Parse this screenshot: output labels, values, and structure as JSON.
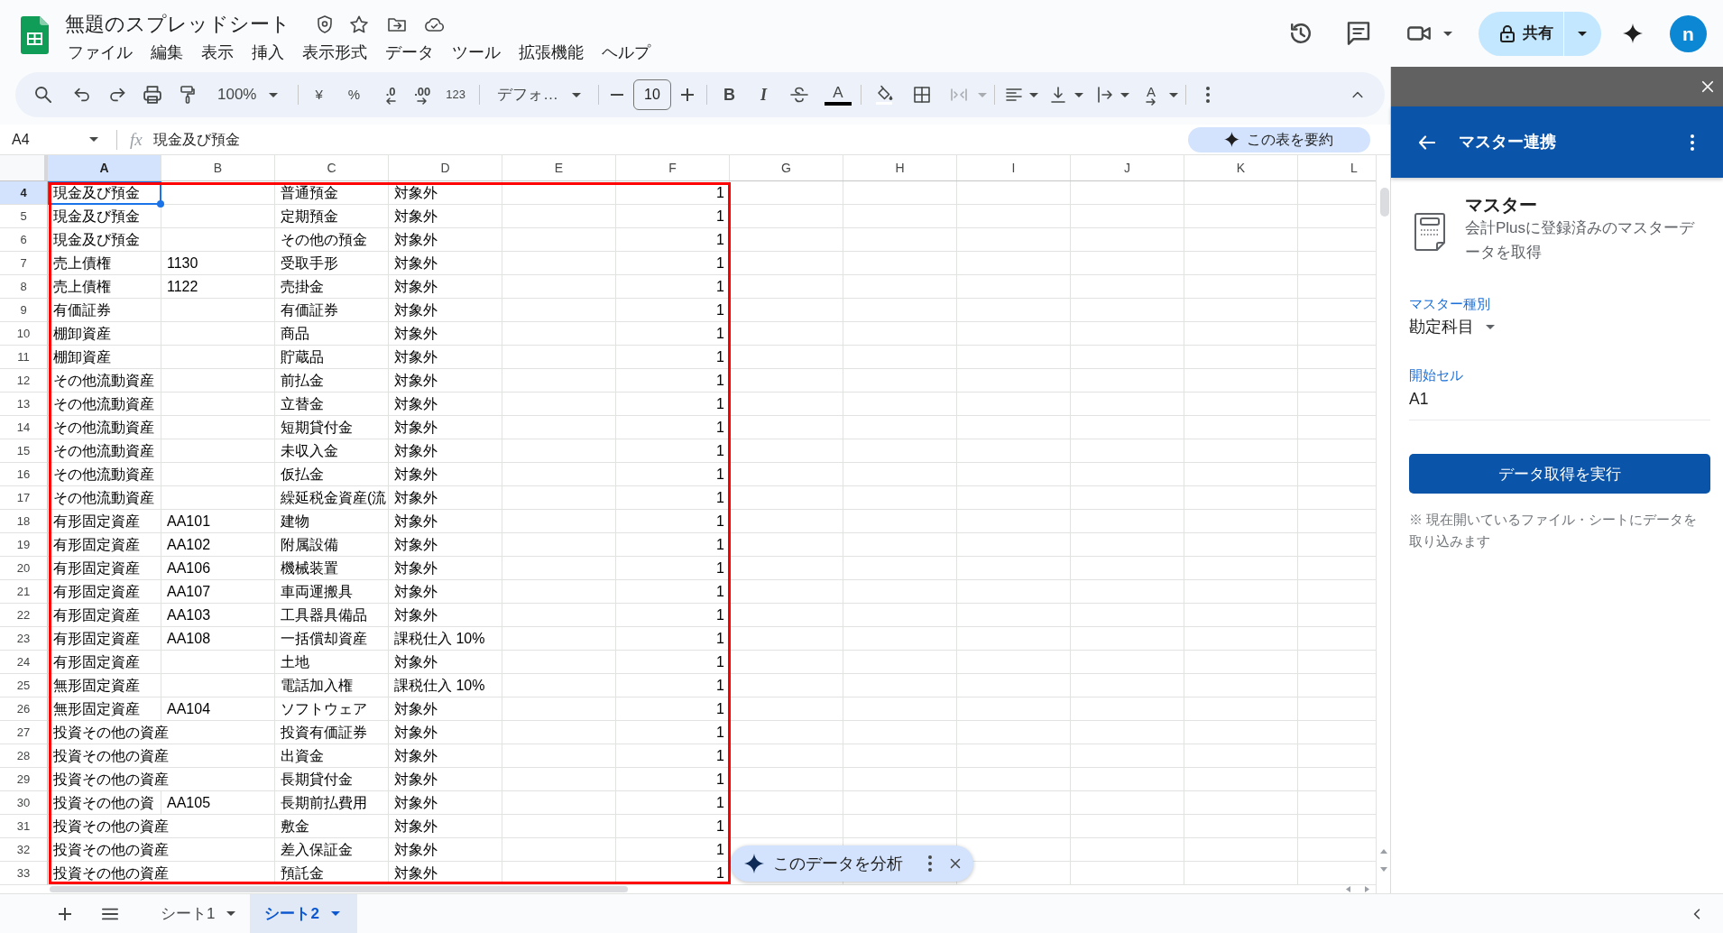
{
  "document": {
    "title": "無題のスプレッドシート"
  },
  "menu": [
    "ファイル",
    "編集",
    "表示",
    "挿入",
    "表示形式",
    "データ",
    "ツール",
    "拡張機能",
    "ヘルプ"
  ],
  "share": {
    "label": "共有"
  },
  "account": {
    "initial": "n"
  },
  "toolbar": {
    "zoom": "100%",
    "currency": "¥",
    "percent": "%",
    "decrease_decimal": ".0",
    "increase_decimal": ".00",
    "number_format": "123",
    "font": "デフォ…",
    "font_size": "10",
    "bold": "B",
    "italic": "I",
    "text_color": "A",
    "text_rotation": "A"
  },
  "formula_bar": {
    "cell_reference": "A4",
    "function_label": "fx",
    "content": "現金及び預金",
    "summarize_button": "この表を要約"
  },
  "grid": {
    "annotation_frame": true,
    "columns": [
      {
        "label": "A",
        "kind": "text",
        "selected": true
      },
      {
        "label": "B",
        "kind": "text",
        "selected": false
      },
      {
        "label": "C",
        "kind": "text",
        "selected": false
      },
      {
        "label": "D",
        "kind": "text",
        "selected": false
      },
      {
        "label": "E",
        "kind": "text",
        "selected": false
      },
      {
        "label": "F",
        "kind": "number",
        "selected": false
      },
      {
        "label": "G",
        "kind": "text",
        "selected": false
      },
      {
        "label": "H",
        "kind": "text",
        "selected": false
      },
      {
        "label": "I",
        "kind": "text",
        "selected": false
      },
      {
        "label": "J",
        "kind": "text",
        "selected": false
      },
      {
        "label": "K",
        "kind": "text",
        "selected": false
      },
      {
        "label": "L",
        "kind": "text",
        "selected": false
      }
    ],
    "rows": [
      {
        "number": "4",
        "selected": true,
        "cells": [
          "現金及び預金",
          null,
          "普通預金",
          "対象外",
          null,
          "1"
        ]
      },
      {
        "number": "5",
        "selected": false,
        "cells": [
          "現金及び預金",
          null,
          "定期預金",
          "対象外",
          null,
          "1"
        ]
      },
      {
        "number": "6",
        "selected": false,
        "cells": [
          "現金及び預金",
          null,
          "その他の預金",
          "対象外",
          null,
          "1"
        ]
      },
      {
        "number": "7",
        "selected": false,
        "cells": [
          "売上債権",
          "1130",
          "受取手形",
          "対象外",
          null,
          "1"
        ]
      },
      {
        "number": "8",
        "selected": false,
        "cells": [
          "売上債権",
          "1122",
          "売掛金",
          "対象外",
          null,
          "1"
        ]
      },
      {
        "number": "9",
        "selected": false,
        "cells": [
          "有価証券",
          null,
          "有価証券",
          "対象外",
          null,
          "1"
        ]
      },
      {
        "number": "10",
        "selected": false,
        "cells": [
          "棚卸資産",
          null,
          "商品",
          "対象外",
          null,
          "1"
        ]
      },
      {
        "number": "11",
        "selected": false,
        "cells": [
          "棚卸資産",
          null,
          "貯蔵品",
          "対象外",
          null,
          "1"
        ]
      },
      {
        "number": "12",
        "selected": false,
        "cells": [
          "その他流動資産",
          null,
          "前払金",
          "対象外",
          null,
          "1"
        ]
      },
      {
        "number": "13",
        "selected": false,
        "cells": [
          "その他流動資産",
          null,
          "立替金",
          "対象外",
          null,
          "1"
        ]
      },
      {
        "number": "14",
        "selected": false,
        "cells": [
          "その他流動資産",
          null,
          "短期貸付金",
          "対象外",
          null,
          "1"
        ]
      },
      {
        "number": "15",
        "selected": false,
        "cells": [
          "その他流動資産",
          null,
          "未収入金",
          "対象外",
          null,
          "1"
        ]
      },
      {
        "number": "16",
        "selected": false,
        "cells": [
          "その他流動資産",
          null,
          "仮払金",
          "対象外",
          null,
          "1"
        ]
      },
      {
        "number": "17",
        "selected": false,
        "cells": [
          "その他流動資産",
          null,
          "繰延税金資産(流",
          "対象外",
          null,
          "1"
        ]
      },
      {
        "number": "18",
        "selected": false,
        "cells": [
          "有形固定資産",
          "AA101",
          "建物",
          "対象外",
          null,
          "1"
        ]
      },
      {
        "number": "19",
        "selected": false,
        "cells": [
          "有形固定資産",
          "AA102",
          "附属設備",
          "対象外",
          null,
          "1"
        ]
      },
      {
        "number": "20",
        "selected": false,
        "cells": [
          "有形固定資産",
          "AA106",
          "機械装置",
          "対象外",
          null,
          "1"
        ]
      },
      {
        "number": "21",
        "selected": false,
        "cells": [
          "有形固定資産",
          "AA107",
          "車両運搬具",
          "対象外",
          null,
          "1"
        ]
      },
      {
        "number": "22",
        "selected": false,
        "cells": [
          "有形固定資産",
          "AA103",
          "工具器具備品",
          "対象外",
          null,
          "1"
        ]
      },
      {
        "number": "23",
        "selected": false,
        "cells": [
          "有形固定資産",
          "AA108",
          "一括償却資産",
          "課税仕入 10%",
          null,
          "1"
        ]
      },
      {
        "number": "24",
        "selected": false,
        "cells": [
          "有形固定資産",
          null,
          "土地",
          "対象外",
          null,
          "1"
        ]
      },
      {
        "number": "25",
        "selected": false,
        "cells": [
          "無形固定資産",
          null,
          "電話加入権",
          "課税仕入 10%",
          null,
          "1"
        ]
      },
      {
        "number": "26",
        "selected": false,
        "cells": [
          "無形固定資産",
          "AA104",
          "ソフトウェア",
          "対象外",
          null,
          "1"
        ]
      },
      {
        "number": "27",
        "selected": false,
        "cells": [
          "投資その他の資産",
          null,
          "投資有価証券",
          "対象外",
          null,
          "1"
        ]
      },
      {
        "number": "28",
        "selected": false,
        "cells": [
          "投資その他の資産",
          null,
          "出資金",
          "対象外",
          null,
          "1"
        ]
      },
      {
        "number": "29",
        "selected": false,
        "cells": [
          "投資その他の資産",
          null,
          "長期貸付金",
          "対象外",
          null,
          "1"
        ]
      },
      {
        "number": "30",
        "selected": false,
        "cells": [
          "投資その他の資",
          "AA105",
          "長期前払費用",
          "対象外",
          null,
          "1"
        ]
      },
      {
        "number": "31",
        "selected": false,
        "cells": [
          "投資その他の資産",
          null,
          "敷金",
          "対象外",
          null,
          "1"
        ]
      },
      {
        "number": "32",
        "selected": false,
        "cells": [
          "投資その他の資産",
          null,
          "差入保証金",
          "対象外",
          null,
          "1"
        ]
      },
      {
        "number": "33",
        "selected": false,
        "cells": [
          "投資その他の資産",
          null,
          "預託金",
          "対象外",
          null,
          "1"
        ]
      }
    ]
  },
  "analyze_chip": {
    "label": "このデータを分析"
  },
  "side_panel": {
    "title": "マスター連携",
    "heading": "マスター",
    "description": "会計Plusに登録済みのマスターデータを取得",
    "fields": [
      {
        "kind": "dropdown",
        "label": "マスター種別",
        "value": "勘定科目"
      },
      {
        "kind": "text",
        "label": "開始セル",
        "value": "A1"
      }
    ],
    "action_button": "データ取得を実行",
    "note": "※ 現在開いているファイル・シートにデータを取り込みます"
  },
  "sheet_tabs": [
    {
      "label": "シート1",
      "selected": false
    },
    {
      "label": "シート2",
      "selected": true
    }
  ]
}
